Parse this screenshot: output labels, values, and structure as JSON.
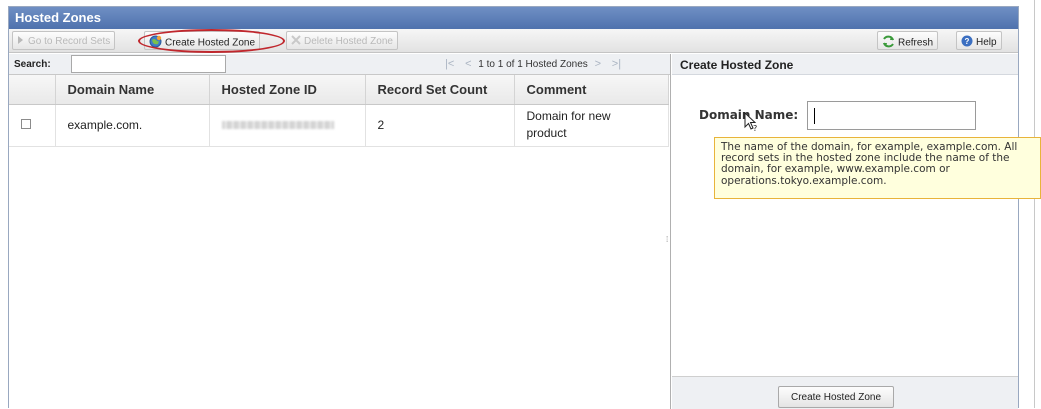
{
  "window": {
    "title": "Hosted Zones"
  },
  "toolbar": {
    "goto_label": "Go to Record Sets",
    "create_label": "Create Hosted Zone",
    "delete_label": "Delete Hosted Zone",
    "refresh_label": "Refresh",
    "help_label": "Help"
  },
  "search": {
    "label": "Search:",
    "value": ""
  },
  "pager": {
    "text": "1 to 1 of 1 Hosted Zones"
  },
  "table": {
    "headers": [
      "Domain Name",
      "Hosted Zone ID",
      "Record Set Count",
      "Comment"
    ],
    "rows": [
      {
        "domain": "example.com.",
        "record_count": "2",
        "comment_line1": "Domain for new",
        "comment_line2": "product"
      }
    ]
  },
  "panel": {
    "title": "Create Hosted Zone",
    "domain_label": "Domain Name:",
    "domain_value": "",
    "tooltip": "The name of the domain, for example, example.com. All record sets in the hosted zone include the name of the domain, for example, www.example.com or operations.tokyo.example.com.",
    "submit_label": "Create Hosted Zone"
  },
  "colors": {
    "title_bar": "#5a7bb5",
    "highlight_ring": "#c0272d",
    "tooltip_bg": "#ffffdd",
    "tooltip_border": "#e8b43a"
  }
}
